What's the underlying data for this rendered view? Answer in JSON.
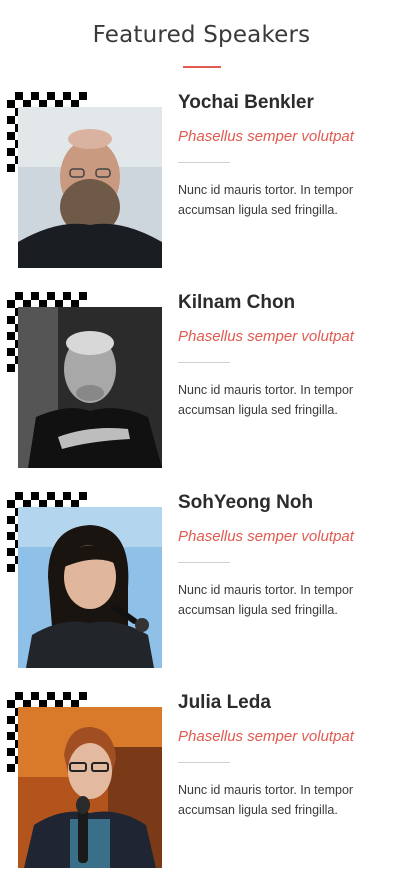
{
  "heading": {
    "title": "Featured Speakers",
    "accent_color": "#e05a4f"
  },
  "speakers": [
    {
      "name": "Yochai Benkler",
      "role": "Phasellus semper volutpat",
      "bio": "Nunc id mauris tortor. In tempor accumsan ligula sed fringilla."
    },
    {
      "name": "Kilnam Chon",
      "role": "Phasellus semper volutpat",
      "bio": "Nunc id mauris tortor. In tempor accumsan ligula sed fringilla."
    },
    {
      "name": "SohYeong Noh",
      "role": "Phasellus semper volutpat",
      "bio": "Nunc id mauris tortor. In tempor accumsan ligula sed fringilla."
    },
    {
      "name": "Julia Leda",
      "role": "Phasellus semper volutpat",
      "bio": "Nunc id mauris tortor. In tempor accumsan ligula sed fringilla."
    }
  ]
}
